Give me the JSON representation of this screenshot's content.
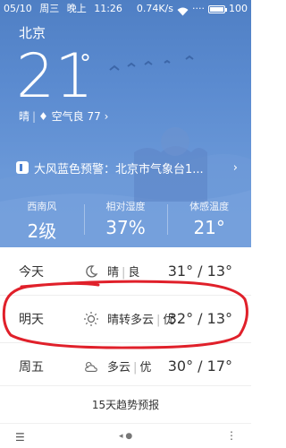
{
  "status_bar": {
    "date": "05/10",
    "weekday": "周三",
    "period": "晚上",
    "time": "11:26",
    "speed": "0.74K/s",
    "battery": "100"
  },
  "weather": {
    "city": "北京",
    "temperature": "21",
    "degree_symbol": "°",
    "condition": "晴",
    "air_quality": "空气良 77",
    "alert": "大风蓝色预警：北京市气象台1...",
    "stats": [
      {
        "label": "西南风",
        "value": "2级"
      },
      {
        "label": "相对湿度",
        "value": "37%"
      },
      {
        "label": "体感温度",
        "value": "21°"
      }
    ]
  },
  "forecast": [
    {
      "day": "今天",
      "icon": "moon-icon",
      "desc": "晴",
      "aqi": "良",
      "range": "31° / 13°"
    },
    {
      "day": "明天",
      "icon": "sun-icon",
      "desc": "晴转多云",
      "aqi": "优",
      "range": "32° / 13°"
    },
    {
      "day": "周五",
      "icon": "partly-cloudy-icon",
      "desc": "多云",
      "aqi": "优",
      "range": "30° / 17°"
    }
  ],
  "trend_label": "15天趋势预报",
  "colors": {
    "sky": "#5b8bd0",
    "annotation": "#e0202a"
  }
}
